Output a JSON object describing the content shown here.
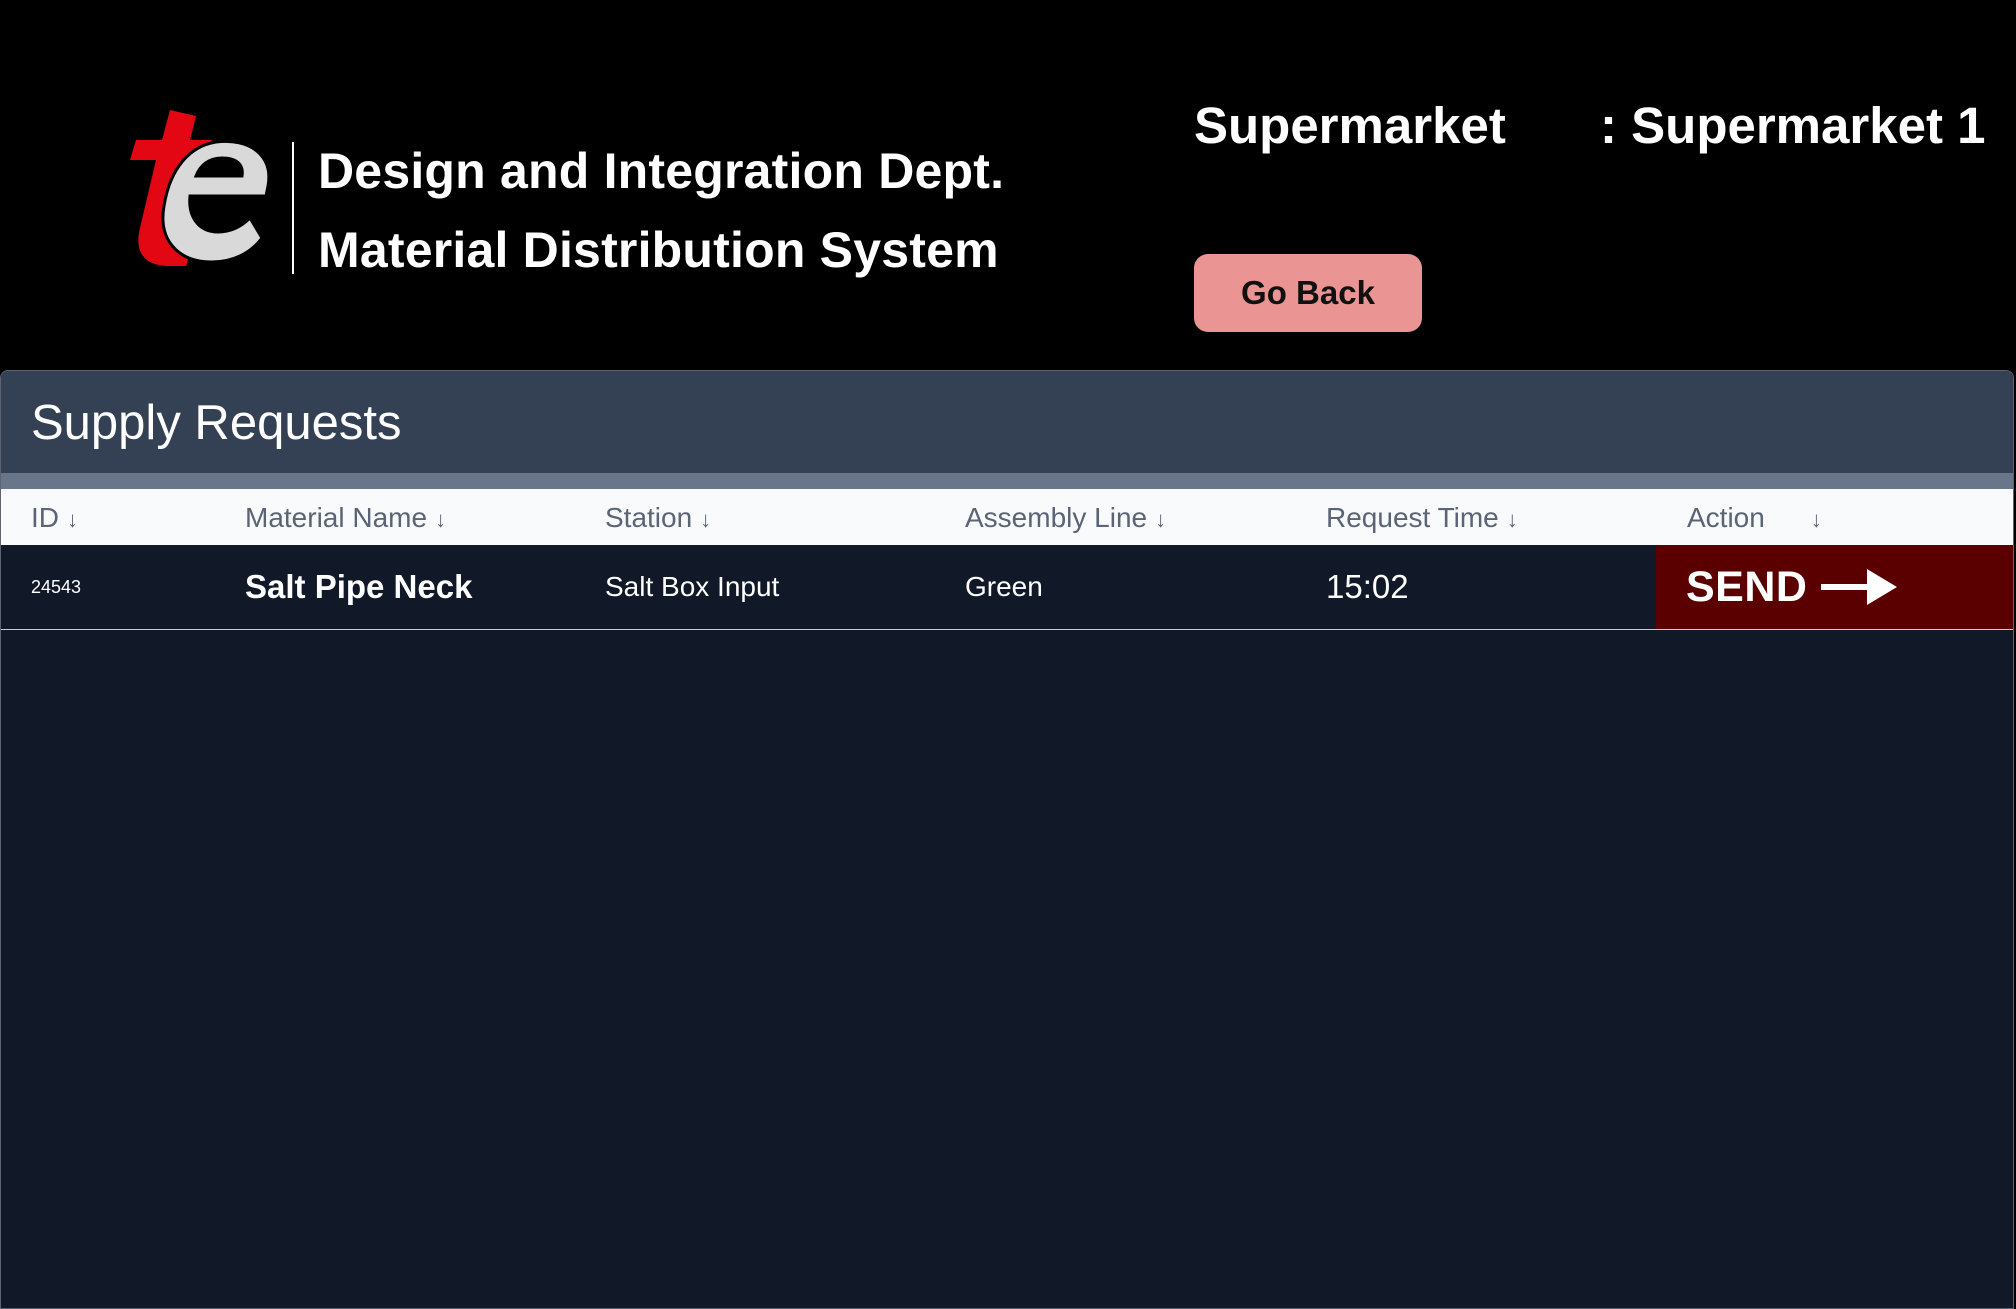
{
  "header": {
    "logo_text": "te",
    "title_line1": "Design and Integration Dept.",
    "title_line2": "Material Distribution System",
    "supermarket_label": "Supermarket",
    "supermarket_value": ": Supermarket 1",
    "go_back_label": "Go Back"
  },
  "panel": {
    "title": "Supply Requests",
    "columns": [
      {
        "label": "ID"
      },
      {
        "label": "Material Name"
      },
      {
        "label": "Station"
      },
      {
        "label": "Assembly Line"
      },
      {
        "label": "Request Time"
      },
      {
        "label": "Action"
      }
    ],
    "sort_icon": "arrow-down-icon",
    "rows": [
      {
        "id": "24543",
        "material_name": "Salt Pipe Neck",
        "station": "Salt Box Input",
        "assembly_line": "Green",
        "request_time": "15:02",
        "action_label": "SEND",
        "action_icon": "arrow-right-icon"
      }
    ]
  },
  "colors": {
    "background": "#000000",
    "panel_header": "#344155",
    "table_body": "#111827",
    "go_back_button": "#ea9493",
    "send_button": "#5b0000",
    "logo_red": "#e30613",
    "logo_grey": "#d9d9d9"
  }
}
